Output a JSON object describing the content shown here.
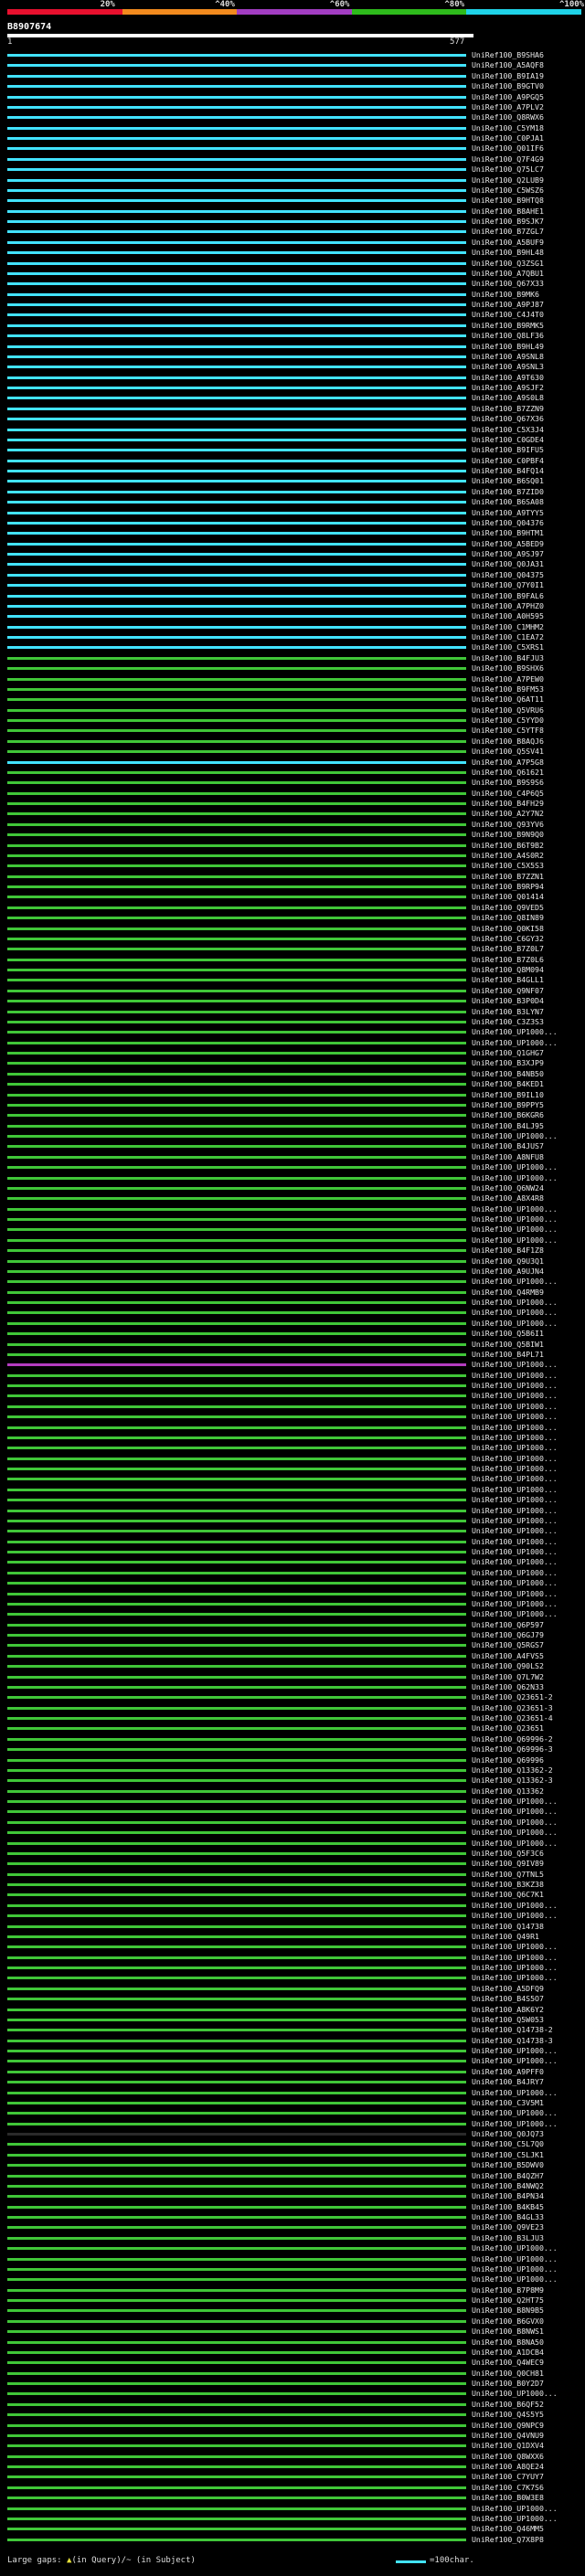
{
  "legend": {
    "labels": [
      "20%",
      "^40%",
      "^60%",
      "^80%",
      "^100%"
    ],
    "colors": [
      "#e8102e",
      "#f28a1e",
      "#a23dc2",
      "#2ebb1c",
      "#1fd3e8"
    ]
  },
  "query": {
    "id": "B8907674",
    "start": "1",
    "end": "577"
  },
  "hit_colors": {
    "cyan": "#42e3ff",
    "green": "#40c638",
    "purple": "#b53cc1",
    "dark": "#2a2a2a"
  },
  "hits": [
    {
      "label": "UniRef100_B9SHA6",
      "color": "cyan"
    },
    {
      "label": "UniRef100_A5AQF8",
      "color": "cyan"
    },
    {
      "label": "UniRef100_B9IA19",
      "color": "cyan"
    },
    {
      "label": "UniRef100_B9GTV0",
      "color": "cyan"
    },
    {
      "label": "UniRef100_A9PGQ5",
      "color": "cyan"
    },
    {
      "label": "UniRef100_A7PLV2",
      "color": "cyan"
    },
    {
      "label": "UniRef100_Q8RWX6",
      "color": "cyan"
    },
    {
      "label": "UniRef100_C5YM18",
      "color": "cyan"
    },
    {
      "label": "UniRef100_C0PJA1",
      "color": "cyan"
    },
    {
      "label": "UniRef100_Q01IF6",
      "color": "cyan"
    },
    {
      "label": "UniRef100_Q7F4G9",
      "color": "cyan"
    },
    {
      "label": "UniRef100_Q75LC7",
      "color": "cyan"
    },
    {
      "label": "UniRef100_Q2LUB9",
      "color": "cyan"
    },
    {
      "label": "UniRef100_C5WSZ6",
      "color": "cyan"
    },
    {
      "label": "UniRef100_B9HTQ8",
      "color": "cyan"
    },
    {
      "label": "UniRef100_B8AHE1",
      "color": "cyan"
    },
    {
      "label": "UniRef100_B9SJK7",
      "color": "cyan"
    },
    {
      "label": "UniRef100_B7ZGL7",
      "color": "cyan"
    },
    {
      "label": "UniRef100_A5BUF9",
      "color": "cyan"
    },
    {
      "label": "UniRef100_B9HL48",
      "color": "cyan"
    },
    {
      "label": "UniRef100_Q3ZSG1",
      "color": "cyan"
    },
    {
      "label": "UniRef100_A7QBU1",
      "color": "cyan"
    },
    {
      "label": "UniRef100_Q67X33",
      "color": "cyan"
    },
    {
      "label": "UniRef100_B9MK6",
      "color": "cyan"
    },
    {
      "label": "UniRef100_A9PJ87",
      "color": "cyan"
    },
    {
      "label": "UniRef100_C4J4T0",
      "color": "cyan"
    },
    {
      "label": "UniRef100_B9RMK5",
      "color": "cyan"
    },
    {
      "label": "UniRef100_Q8LF36",
      "color": "cyan"
    },
    {
      "label": "UniRef100_B9HL49",
      "color": "cyan"
    },
    {
      "label": "UniRef100_A9SNL8",
      "color": "cyan"
    },
    {
      "label": "UniRef100_A9SNL3",
      "color": "cyan"
    },
    {
      "label": "UniRef100_A9T630",
      "color": "cyan"
    },
    {
      "label": "UniRef100_A9SJF2",
      "color": "cyan"
    },
    {
      "label": "UniRef100_A9S0L8",
      "color": "cyan"
    },
    {
      "label": "UniRef100_B7ZZN9",
      "color": "cyan"
    },
    {
      "label": "UniRef100_Q67X36",
      "color": "cyan"
    },
    {
      "label": "UniRef100_C5X3J4",
      "color": "cyan"
    },
    {
      "label": "UniRef100_C0GDE4",
      "color": "cyan"
    },
    {
      "label": "UniRef100_B9IFU5",
      "color": "cyan"
    },
    {
      "label": "UniRef100_C0PBF4",
      "color": "cyan"
    },
    {
      "label": "UniRef100_B4FQ14",
      "color": "cyan"
    },
    {
      "label": "UniRef100_B6SQ01",
      "color": "cyan"
    },
    {
      "label": "UniRef100_B7ZID0",
      "color": "cyan"
    },
    {
      "label": "UniRef100_B6SA08",
      "color": "cyan"
    },
    {
      "label": "UniRef100_A9TYY5",
      "color": "cyan"
    },
    {
      "label": "UniRef100_Q04376",
      "color": "cyan"
    },
    {
      "label": "UniRef100_B9HTM1",
      "color": "cyan"
    },
    {
      "label": "UniRef100_A5BED9",
      "color": "cyan"
    },
    {
      "label": "UniRef100_A9SJ97",
      "color": "cyan"
    },
    {
      "label": "UniRef100_Q0JA31",
      "color": "cyan"
    },
    {
      "label": "UniRef100_Q04375",
      "color": "cyan"
    },
    {
      "label": "UniRef100_Q7Y0I1",
      "color": "cyan"
    },
    {
      "label": "UniRef100_B9FAL6",
      "color": "cyan"
    },
    {
      "label": "UniRef100_A7PHZ0",
      "color": "cyan"
    },
    {
      "label": "UniRef100_A0H595",
      "color": "cyan"
    },
    {
      "label": "UniRef100_C1MHM2",
      "color": "cyan"
    },
    {
      "label": "UniRef100_C1EA72",
      "color": "cyan"
    },
    {
      "label": "UniRef100_C5XRS1",
      "color": "cyan"
    },
    {
      "label": "UniRef100_B4FJU3",
      "color": "green"
    },
    {
      "label": "UniRef100_B9SHX6",
      "color": "green"
    },
    {
      "label": "UniRef100_A7PEW0",
      "color": "green"
    },
    {
      "label": "UniRef100_B9FM53",
      "color": "green"
    },
    {
      "label": "UniRef100_Q6AT11",
      "color": "green"
    },
    {
      "label": "UniRef100_Q5VRU6",
      "color": "green"
    },
    {
      "label": "UniRef100_C5YYD0",
      "color": "green"
    },
    {
      "label": "UniRef100_C5YTF8",
      "color": "green"
    },
    {
      "label": "UniRef100_B8AQJ6",
      "color": "green"
    },
    {
      "label": "UniRef100_Q5SV41",
      "color": "green"
    },
    {
      "label": "UniRef100_A7P5G8",
      "color": "cyan"
    },
    {
      "label": "UniRef100_Q61621",
      "color": "green"
    },
    {
      "label": "UniRef100_B9S9S6",
      "color": "green"
    },
    {
      "label": "UniRef100_C4P6Q5",
      "color": "green"
    },
    {
      "label": "UniRef100_B4FH29",
      "color": "green"
    },
    {
      "label": "UniRef100_A2Y7N2",
      "color": "green"
    },
    {
      "label": "UniRef100_Q93YV6",
      "color": "green"
    },
    {
      "label": "UniRef100_B9N9Q0",
      "color": "green"
    },
    {
      "label": "UniRef100_B6T9B2",
      "color": "green"
    },
    {
      "label": "UniRef100_A4S0R2",
      "color": "green"
    },
    {
      "label": "UniRef100_C5X5S3",
      "color": "green"
    },
    {
      "label": "UniRef100_B7ZZN1",
      "color": "green"
    },
    {
      "label": "UniRef100_B9RP94",
      "color": "green"
    },
    {
      "label": "UniRef100_Q01414",
      "color": "green"
    },
    {
      "label": "UniRef100_Q9VED5",
      "color": "green"
    },
    {
      "label": "UniRef100_Q8IN89",
      "color": "green"
    },
    {
      "label": "UniRef100_Q0KI58",
      "color": "green"
    },
    {
      "label": "UniRef100_C6GY32",
      "color": "green"
    },
    {
      "label": "UniRef100_B7Z0L7",
      "color": "green"
    },
    {
      "label": "UniRef100_B7Z0L6",
      "color": "green"
    },
    {
      "label": "UniRef100_Q8M094",
      "color": "green"
    },
    {
      "label": "UniRef100_B4GLL1",
      "color": "green"
    },
    {
      "label": "UniRef100_Q9NF07",
      "color": "green"
    },
    {
      "label": "UniRef100_B3P0D4",
      "color": "green"
    },
    {
      "label": "UniRef100_B3LYN7",
      "color": "green"
    },
    {
      "label": "UniRef100_C3Z3S3",
      "color": "green"
    },
    {
      "label": "UniRef100_UP1000...",
      "color": "green"
    },
    {
      "label": "UniRef100_UP1000...",
      "color": "green"
    },
    {
      "label": "UniRef100_Q1GHG7",
      "color": "green"
    },
    {
      "label": "UniRef100_B3XJP9",
      "color": "green"
    },
    {
      "label": "UniRef100_B4NB50",
      "color": "green"
    },
    {
      "label": "UniRef100_B4KED1",
      "color": "green"
    },
    {
      "label": "UniRef100_B9IL10",
      "color": "green"
    },
    {
      "label": "UniRef100_B9PPY5",
      "color": "green"
    },
    {
      "label": "UniRef100_B6KGR6",
      "color": "green"
    },
    {
      "label": "UniRef100_B4LJ95",
      "color": "green"
    },
    {
      "label": "UniRef100_UP1000...",
      "color": "green"
    },
    {
      "label": "UniRef100_B4JUS7",
      "color": "green"
    },
    {
      "label": "UniRef100_A8NFU8",
      "color": "green"
    },
    {
      "label": "UniRef100_UP1000...",
      "color": "green"
    },
    {
      "label": "UniRef100_UP1000...",
      "color": "green"
    },
    {
      "label": "UniRef100_Q6NW24",
      "color": "green"
    },
    {
      "label": "UniRef100_A8X4R8",
      "color": "green"
    },
    {
      "label": "UniRef100_UP1000...",
      "color": "green"
    },
    {
      "label": "UniRef100_UP1000...",
      "color": "green"
    },
    {
      "label": "UniRef100_UP1000...",
      "color": "green"
    },
    {
      "label": "UniRef100_UP1000...",
      "color": "green"
    },
    {
      "label": "UniRef100_B4F1Z8",
      "color": "green"
    },
    {
      "label": "UniRef100_Q9U3Q1",
      "color": "green"
    },
    {
      "label": "UniRef100_A9UJN4",
      "color": "green"
    },
    {
      "label": "UniRef100_UP1000...",
      "color": "green"
    },
    {
      "label": "UniRef100_Q4RMB9",
      "color": "green"
    },
    {
      "label": "UniRef100_UP1000...",
      "color": "green"
    },
    {
      "label": "UniRef100_UP1000...",
      "color": "green"
    },
    {
      "label": "UniRef100_UP1000...",
      "color": "green"
    },
    {
      "label": "UniRef100_Q5B6I1",
      "color": "green"
    },
    {
      "label": "UniRef100_Q5BIW1",
      "color": "green"
    },
    {
      "label": "UniRef100_B4PL71",
      "color": "green"
    },
    {
      "label": "UniRef100_UP1000...",
      "color": "purple"
    },
    {
      "label": "UniRef100_UP1000...",
      "color": "green"
    },
    {
      "label": "UniRef100_UP1000...",
      "color": "green"
    },
    {
      "label": "UniRef100_UP1000...",
      "color": "green"
    },
    {
      "label": "UniRef100_UP1000...",
      "color": "green"
    },
    {
      "label": "UniRef100_UP1000...",
      "color": "green"
    },
    {
      "label": "UniRef100_UP1000...",
      "color": "green"
    },
    {
      "label": "UniRef100_UP1000...",
      "color": "green"
    },
    {
      "label": "UniRef100_UP1000...",
      "color": "green"
    },
    {
      "label": "UniRef100_UP1000...",
      "color": "green"
    },
    {
      "label": "UniRef100_UP1000...",
      "color": "green"
    },
    {
      "label": "UniRef100_UP1000...",
      "color": "green"
    },
    {
      "label": "UniRef100_UP1000...",
      "color": "green"
    },
    {
      "label": "UniRef100_UP1000...",
      "color": "green"
    },
    {
      "label": "UniRef100_UP1000...",
      "color": "green"
    },
    {
      "label": "UniRef100_UP1000...",
      "color": "green"
    },
    {
      "label": "UniRef100_UP1000...",
      "color": "green"
    },
    {
      "label": "UniRef100_UP1000...",
      "color": "green"
    },
    {
      "label": "UniRef100_UP1000...",
      "color": "green"
    },
    {
      "label": "UniRef100_UP1000...",
      "color": "green"
    },
    {
      "label": "UniRef100_UP1000...",
      "color": "green"
    },
    {
      "label": "UniRef100_UP1000...",
      "color": "green"
    },
    {
      "label": "UniRef100_UP1000...",
      "color": "green"
    },
    {
      "label": "UniRef100_UP1000...",
      "color": "green"
    },
    {
      "label": "UniRef100_UP1000...",
      "color": "green"
    },
    {
      "label": "UniRef100_Q6P597",
      "color": "green"
    },
    {
      "label": "UniRef100_Q6GJ79",
      "color": "green"
    },
    {
      "label": "UniRef100_Q5RGS7",
      "color": "green"
    },
    {
      "label": "UniRef100_A4FVS5",
      "color": "green"
    },
    {
      "label": "UniRef100_Q90LS2",
      "color": "green"
    },
    {
      "label": "UniRef100_Q7L7W2",
      "color": "green"
    },
    {
      "label": "UniRef100_Q62N33",
      "color": "green"
    },
    {
      "label": "UniRef100_Q23651-2",
      "color": "green"
    },
    {
      "label": "UniRef100_Q23651-3",
      "color": "green"
    },
    {
      "label": "UniRef100_Q23651-4",
      "color": "green"
    },
    {
      "label": "UniRef100_Q23651",
      "color": "green"
    },
    {
      "label": "UniRef100_Q69996-2",
      "color": "green"
    },
    {
      "label": "UniRef100_Q69996-3",
      "color": "green"
    },
    {
      "label": "UniRef100_Q69996",
      "color": "green"
    },
    {
      "label": "UniRef100_Q13362-2",
      "color": "green"
    },
    {
      "label": "UniRef100_Q13362-3",
      "color": "green"
    },
    {
      "label": "UniRef100_Q13362",
      "color": "green"
    },
    {
      "label": "UniRef100_UP1000...",
      "color": "green"
    },
    {
      "label": "UniRef100_UP1000...",
      "color": "green"
    },
    {
      "label": "UniRef100_UP1000...",
      "color": "green"
    },
    {
      "label": "UniRef100_UP1000...",
      "color": "green"
    },
    {
      "label": "UniRef100_UP1000...",
      "color": "green"
    },
    {
      "label": "UniRef100_Q5F3C6",
      "color": "green"
    },
    {
      "label": "UniRef100_Q9IV89",
      "color": "green"
    },
    {
      "label": "UniRef100_Q7TNL5",
      "color": "green"
    },
    {
      "label": "UniRef100_B3KZ38",
      "color": "green"
    },
    {
      "label": "UniRef100_Q6C7K1",
      "color": "green"
    },
    {
      "label": "UniRef100_UP1000...",
      "color": "green"
    },
    {
      "label": "UniRef100_UP1000...",
      "color": "green"
    },
    {
      "label": "UniRef100_Q14738",
      "color": "green"
    },
    {
      "label": "UniRef100_Q49R1",
      "color": "green"
    },
    {
      "label": "UniRef100_UP1000...",
      "color": "green"
    },
    {
      "label": "UniRef100_UP1000...",
      "color": "green"
    },
    {
      "label": "UniRef100_UP1000...",
      "color": "green"
    },
    {
      "label": "UniRef100_UP1000...",
      "color": "green"
    },
    {
      "label": "UniRef100_A5DFQ9",
      "color": "green"
    },
    {
      "label": "UniRef100_B4S5O7",
      "color": "green"
    },
    {
      "label": "UniRef100_A8K6Y2",
      "color": "green"
    },
    {
      "label": "UniRef100_Q5W053",
      "color": "green"
    },
    {
      "label": "UniRef100_Q14738-2",
      "color": "green"
    },
    {
      "label": "UniRef100_Q14738-3",
      "color": "green"
    },
    {
      "label": "UniRef100_UP1000...",
      "color": "green"
    },
    {
      "label": "UniRef100_UP1000...",
      "color": "green"
    },
    {
      "label": "UniRef100_A9PFF0",
      "color": "green"
    },
    {
      "label": "UniRef100_B4JRY7",
      "color": "green"
    },
    {
      "label": "UniRef100_UP1000...",
      "color": "green"
    },
    {
      "label": "UniRef100_C3V5M1",
      "color": "green"
    },
    {
      "label": "UniRef100_UP1000...",
      "color": "green"
    },
    {
      "label": "UniRef100_UP1000...",
      "color": "green"
    },
    {
      "label": "UniRef100_Q0JQ73",
      "color": "dark"
    },
    {
      "label": "UniRef100_C5L7Q0",
      "color": "green"
    },
    {
      "label": "UniRef100_C5LJK1",
      "color": "green"
    },
    {
      "label": "UniRef100_B5DWV0",
      "color": "green"
    },
    {
      "label": "UniRef100_B4QZH7",
      "color": "green"
    },
    {
      "label": "UniRef100_B4NWQ2",
      "color": "green"
    },
    {
      "label": "UniRef100_B4PN34",
      "color": "green"
    },
    {
      "label": "UniRef100_B4KB45",
      "color": "green"
    },
    {
      "label": "UniRef100_B4GL33",
      "color": "green"
    },
    {
      "label": "UniRef100_Q9VE23",
      "color": "green"
    },
    {
      "label": "UniRef100_B3LJU3",
      "color": "green"
    },
    {
      "label": "UniRef100_UP1000...",
      "color": "green"
    },
    {
      "label": "UniRef100_UP1000...",
      "color": "green"
    },
    {
      "label": "UniRef100_UP1000...",
      "color": "green"
    },
    {
      "label": "UniRef100_UP1000...",
      "color": "green"
    },
    {
      "label": "UniRef100_B7P8M9",
      "color": "green"
    },
    {
      "label": "UniRef100_Q2HT75",
      "color": "green"
    },
    {
      "label": "UniRef100_B8N9B5",
      "color": "green"
    },
    {
      "label": "UniRef100_B6GVX0",
      "color": "green"
    },
    {
      "label": "UniRef100_B8NWS1",
      "color": "green"
    },
    {
      "label": "UniRef100_B8NA50",
      "color": "green"
    },
    {
      "label": "UniRef100_A1DCB4",
      "color": "green"
    },
    {
      "label": "UniRef100_Q4WEC9",
      "color": "green"
    },
    {
      "label": "UniRef100_Q0CH81",
      "color": "green"
    },
    {
      "label": "UniRef100_B0Y2D7",
      "color": "green"
    },
    {
      "label": "UniRef100_UP1000...",
      "color": "green"
    },
    {
      "label": "UniRef100_B6QF52",
      "color": "green"
    },
    {
      "label": "UniRef100_Q4S5Y5",
      "color": "green"
    },
    {
      "label": "UniRef100_Q9NPC9",
      "color": "green"
    },
    {
      "label": "UniRef100_Q4VNU9",
      "color": "green"
    },
    {
      "label": "UniRef100_Q1DXV4",
      "color": "green"
    },
    {
      "label": "UniRef100_Q8WXX6",
      "color": "green"
    },
    {
      "label": "UniRef100_A8QE24",
      "color": "green"
    },
    {
      "label": "UniRef100_C7YUY7",
      "color": "green"
    },
    {
      "label": "UniRef100_C7K7S6",
      "color": "green"
    },
    {
      "label": "UniRef100_B0W3E8",
      "color": "green"
    },
    {
      "label": "UniRef100_UP1000...",
      "color": "green"
    },
    {
      "label": "UniRef100_UP1000...",
      "color": "green"
    },
    {
      "label": "UniRef100_Q46MM5",
      "color": "green"
    },
    {
      "label": "UniRef100_Q7X8P8",
      "color": "green"
    }
  ],
  "footer": {
    "large_gaps": "Large gaps:",
    "in_query": "(in Query)/",
    "in_subject": "~ (in Subject)",
    "key_label": "=100char."
  }
}
